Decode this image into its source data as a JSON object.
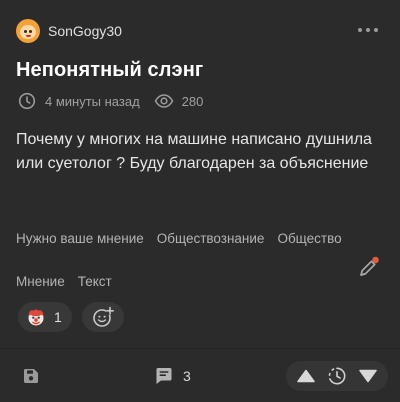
{
  "post": {
    "author": {
      "name": "SonGogy30",
      "avatar_icon": "face-avatar-icon"
    },
    "title": "Непонятный слэнг",
    "time_ago": "4 минуты назад",
    "views": "280",
    "text": "Почему у многих на машине написано душнила или суетолог ? Буду благодарен за объяснение"
  },
  "tags": {
    "line1": [
      "Нужно ваше мнение",
      "Обществознание",
      "Общество"
    ],
    "line2": [
      "Мнение",
      "Текст"
    ]
  },
  "reactions": [
    {
      "icon": "clown-emoji-icon",
      "count": "1"
    }
  ],
  "bottom_bar": {
    "comments_count": "3"
  },
  "colors": {
    "background": "#2b2b2b",
    "accent": "#e25b45",
    "muted": "#a0a0a0"
  }
}
